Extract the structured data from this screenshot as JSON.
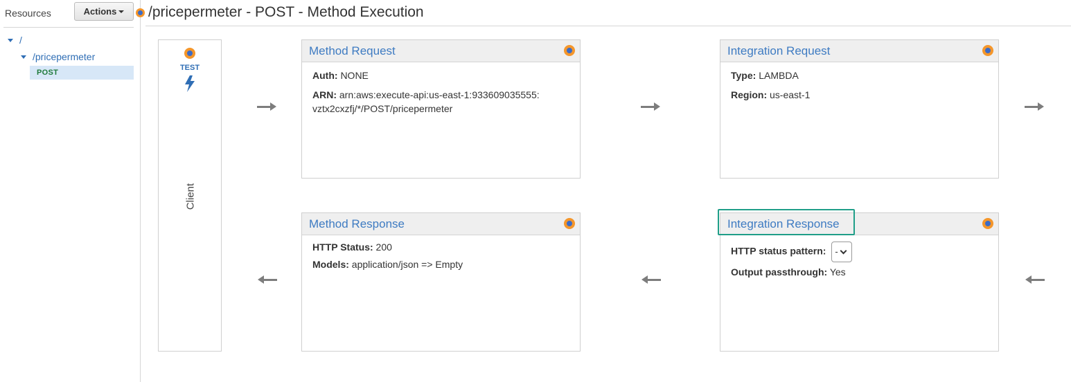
{
  "sidebar": {
    "title": "Resources",
    "actions_label": "Actions",
    "tree": {
      "root": "/",
      "resource": "/pricepermeter",
      "method": "POST"
    }
  },
  "header": {
    "title": "/pricepermeter - POST - Method Execution"
  },
  "client": {
    "test_label": "TEST",
    "label": "Client"
  },
  "method_request": {
    "title": "Method Request",
    "auth_key": "Auth:",
    "auth_value": "NONE",
    "arn_key": "ARN:",
    "arn_value": "arn:aws:execute-api:us-east-1:933609035555:vztx2cxzfj/*/POST/pricepermeter"
  },
  "integration_request": {
    "title": "Integration Request",
    "type_key": "Type:",
    "type_value": "LAMBDA",
    "region_key": "Region:",
    "region_value": "us-east-1"
  },
  "method_response": {
    "title": "Method Response",
    "status_key": "HTTP Status:",
    "status_value": "200",
    "models_key": "Models:",
    "models_value": "application/json => Empty"
  },
  "integration_response": {
    "title": "Integration Response",
    "pattern_key": "HTTP status pattern:",
    "pattern_value": "-",
    "passthrough_key": "Output passthrough:",
    "passthrough_value": "Yes"
  },
  "colors": {
    "accent_blue": "#3e7bc2",
    "dot_orange": "#f4962b",
    "highlight_teal": "#1f9e88",
    "post_green": "#1f7a3b"
  },
  "icons": [
    "caret-down-icon",
    "tree-expand-icon",
    "status-dot-icon",
    "lightning-bolt-icon",
    "arrow-right-icon",
    "arrow-left-icon",
    "chevron-down-icon"
  ]
}
